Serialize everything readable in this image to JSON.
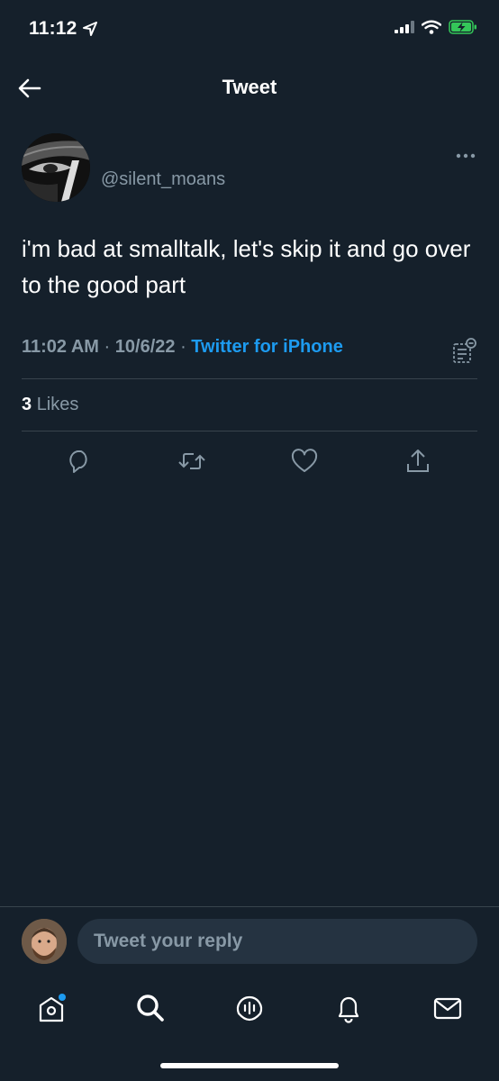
{
  "status_bar": {
    "time": "11:12",
    "icons": [
      "location-arrow-icon",
      "cellular-signal-icon",
      "wifi-icon",
      "battery-charging-icon"
    ]
  },
  "header": {
    "title": "Tweet",
    "back_icon": "back-arrow-icon"
  },
  "tweet": {
    "handle": "@silent_moans",
    "text": "i'm bad at smalltalk, let's skip it and go over to the good part",
    "time": "11:02 AM",
    "separator": "·",
    "date": "10/6/22",
    "source": "Twitter for iPhone",
    "likes_count": "3",
    "likes_label": "Likes",
    "more_icon": "more-dots-icon",
    "actions": [
      "reply-icon",
      "retweet-icon",
      "like-icon",
      "share-icon"
    ]
  },
  "reply": {
    "placeholder": "Tweet your reply"
  },
  "tabbar": {
    "items": [
      "home-icon",
      "search-icon",
      "spaces-icon",
      "notifications-icon",
      "messages-icon"
    ],
    "home_badge_color": "#1d9bf0"
  },
  "colors": {
    "background": "#15202b",
    "secondary_text": "#8899a6",
    "accent": "#1d9bf0",
    "divider": "#38444d",
    "battery": "#34c759"
  }
}
